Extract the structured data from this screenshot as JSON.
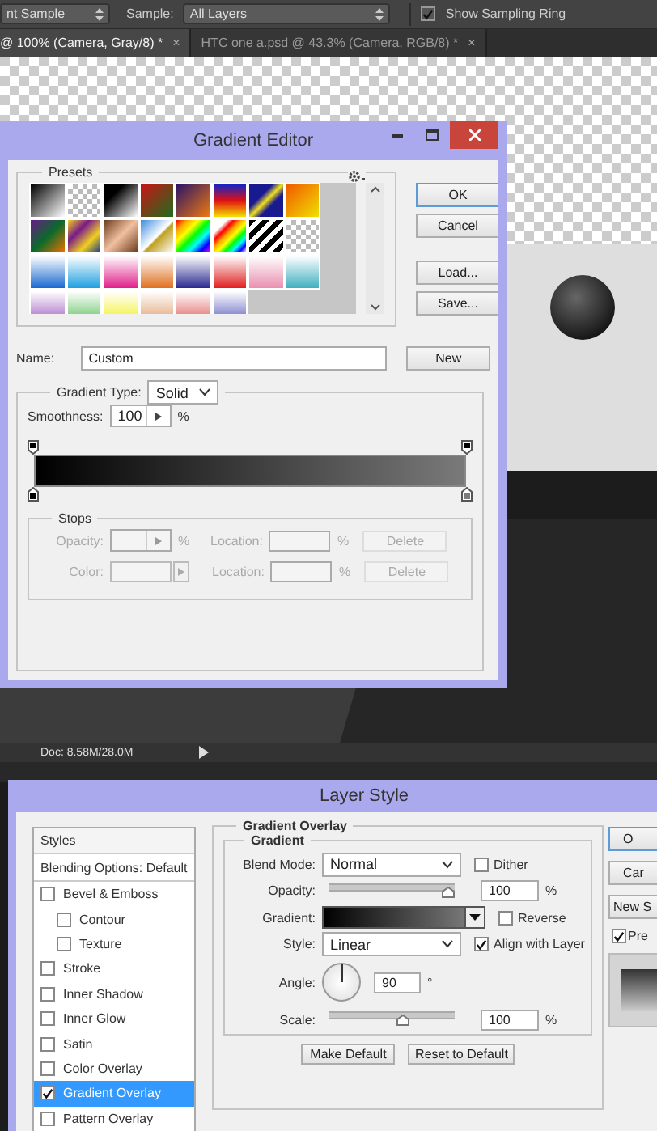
{
  "options_bar": {
    "sample_size": "nt Sample",
    "sample_label": "Sample:",
    "sample": "All Layers",
    "show_sampling_ring": {
      "label": "Show Sampling Ring",
      "checked": true
    }
  },
  "document_tabs": [
    {
      "label": "@ 100% (Camera, Gray/8) *",
      "close": "×",
      "selected": true
    },
    {
      "label": "HTC one a.psd @ 43.3% (Camera, RGB/8) *",
      "close": "×",
      "selected": false
    }
  ],
  "gradient_editor": {
    "title": "Gradient Editor",
    "presets_label": "Presets",
    "buttons": [
      "OK",
      "Cancel",
      "Load...",
      "Save..."
    ],
    "name_label": "Name:",
    "name": "Custom",
    "new_button": "New",
    "gradient_type_label": "Gradient Type:",
    "gradient_type": "Solid",
    "smoothness_label": "Smoothness:",
    "smoothness": "100",
    "smoothness_unit": "%",
    "opacity_stops": [
      {
        "color": "#000000"
      },
      {
        "color": "#000000"
      }
    ],
    "color_stops": [
      {
        "color": "#000000"
      },
      {
        "color": "#7a7a7a"
      }
    ],
    "stops": {
      "label": "Stops",
      "disabled": true,
      "rows": [
        {
          "kind": "opacity",
          "label": "Opacity:",
          "unit": "%",
          "location_label": "Location:",
          "location_unit": "%",
          "delete": "Delete"
        },
        {
          "kind": "color",
          "label": "Color:",
          "location_label": "Location:",
          "location_unit": "%",
          "delete": "Delete"
        }
      ]
    }
  },
  "status_bar": {
    "doc": "Doc: 8.58M/28.0M"
  },
  "layer_style": {
    "title": "Layer Style",
    "styles_header": "Styles",
    "blending_options": "Blending Options: Default",
    "effects": [
      {
        "label": "Bevel & Emboss",
        "checked": false,
        "selected": false,
        "children": [
          {
            "label": "Contour",
            "checked": false,
            "selected": false
          },
          {
            "label": "Texture",
            "checked": false,
            "selected": false
          }
        ]
      },
      {
        "label": "Stroke",
        "checked": false,
        "selected": false
      },
      {
        "label": "Inner Shadow",
        "checked": false,
        "selected": false
      },
      {
        "label": "Inner Glow",
        "checked": false,
        "selected": false
      },
      {
        "label": "Satin",
        "checked": false,
        "selected": false
      },
      {
        "label": "Color Overlay",
        "checked": false,
        "selected": false
      },
      {
        "label": "Gradient Overlay",
        "checked": true,
        "selected": true
      },
      {
        "label": "Pattern Overlay",
        "checked": false,
        "selected": false
      }
    ],
    "section_title": "Gradient Overlay",
    "group_title": "Gradient",
    "rows": [
      {
        "kind": "select",
        "label": "Blend Mode:",
        "value": "Normal",
        "option": {
          "label": "Dither",
          "checked": false
        }
      },
      {
        "kind": "slider",
        "label": "Opacity:",
        "level": 1,
        "value": "100",
        "unit": "%"
      },
      {
        "kind": "gradient",
        "label": "Gradient:",
        "option": {
          "label": "Reverse",
          "checked": false
        }
      },
      {
        "kind": "select",
        "label": "Style:",
        "value": "Linear",
        "option": {
          "label": "Align with Layer",
          "checked": true
        }
      },
      {
        "kind": "angle",
        "label": "Angle:",
        "value": "90",
        "unit": "°"
      },
      {
        "kind": "slider",
        "label": "Scale:",
        "level": 0.6,
        "value": "100",
        "unit": "%"
      }
    ],
    "footer_buttons": [
      "Make Default",
      "Reset to Default"
    ],
    "side_buttons": [
      "O",
      "Car",
      "New S"
    ],
    "preview": {
      "label": "Pre",
      "checked": true
    }
  }
}
